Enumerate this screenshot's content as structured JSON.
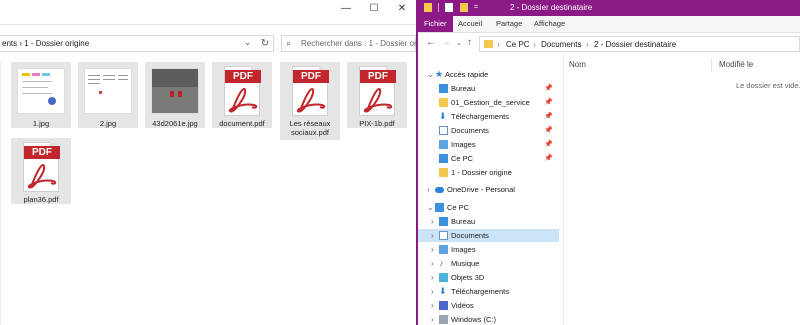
{
  "left_window": {
    "controls": {
      "minimize": "—",
      "maximize": "☐",
      "close": "✕"
    },
    "address": "ents  ›  1 - Dossier origine",
    "search_placeholder": "Rechercher dans : 1 - Dossier ori...",
    "files": [
      {
        "name": "1.jpg",
        "kind": "image-doc"
      },
      {
        "name": "2.jpg",
        "kind": "image-doc"
      },
      {
        "name": "43d2061e.jpg",
        "kind": "image-photo"
      },
      {
        "name": "document.pdf",
        "kind": "pdf"
      },
      {
        "name": "Les réseaux sociaux.pdf",
        "kind": "pdf"
      },
      {
        "name": "PIX-1b.pdf",
        "kind": "pdf"
      },
      {
        "name": "plan36.pdf",
        "kind": "pdf"
      }
    ],
    "pdf_badge": "PDF"
  },
  "right_window": {
    "title": "2 - Dossier destinataire",
    "tabs": [
      "Fichier",
      "Accueil",
      "Partage",
      "Affichage"
    ],
    "address_crumbs": [
      "Ce PC",
      "Documents",
      "2 - Dossier destinataire"
    ],
    "columns": {
      "name": "Nom",
      "modified": "Modifié le"
    },
    "empty_message": "Le dossier est vide.",
    "nav": {
      "quick_access": "Accès rapide",
      "quick_items": [
        "Bureau",
        "01_Gestion_de_service",
        "Téléchargements",
        "Documents",
        "Images",
        "Ce PC",
        "1 - Dossier origine"
      ],
      "onedrive": "OneDrive - Personal",
      "this_pc": "Ce PC",
      "pc_items": [
        "Bureau",
        "Documents",
        "Images",
        "Musique",
        "Objets 3D",
        "Téléchargements",
        "Vidéos",
        "Windows (C:)"
      ]
    }
  }
}
